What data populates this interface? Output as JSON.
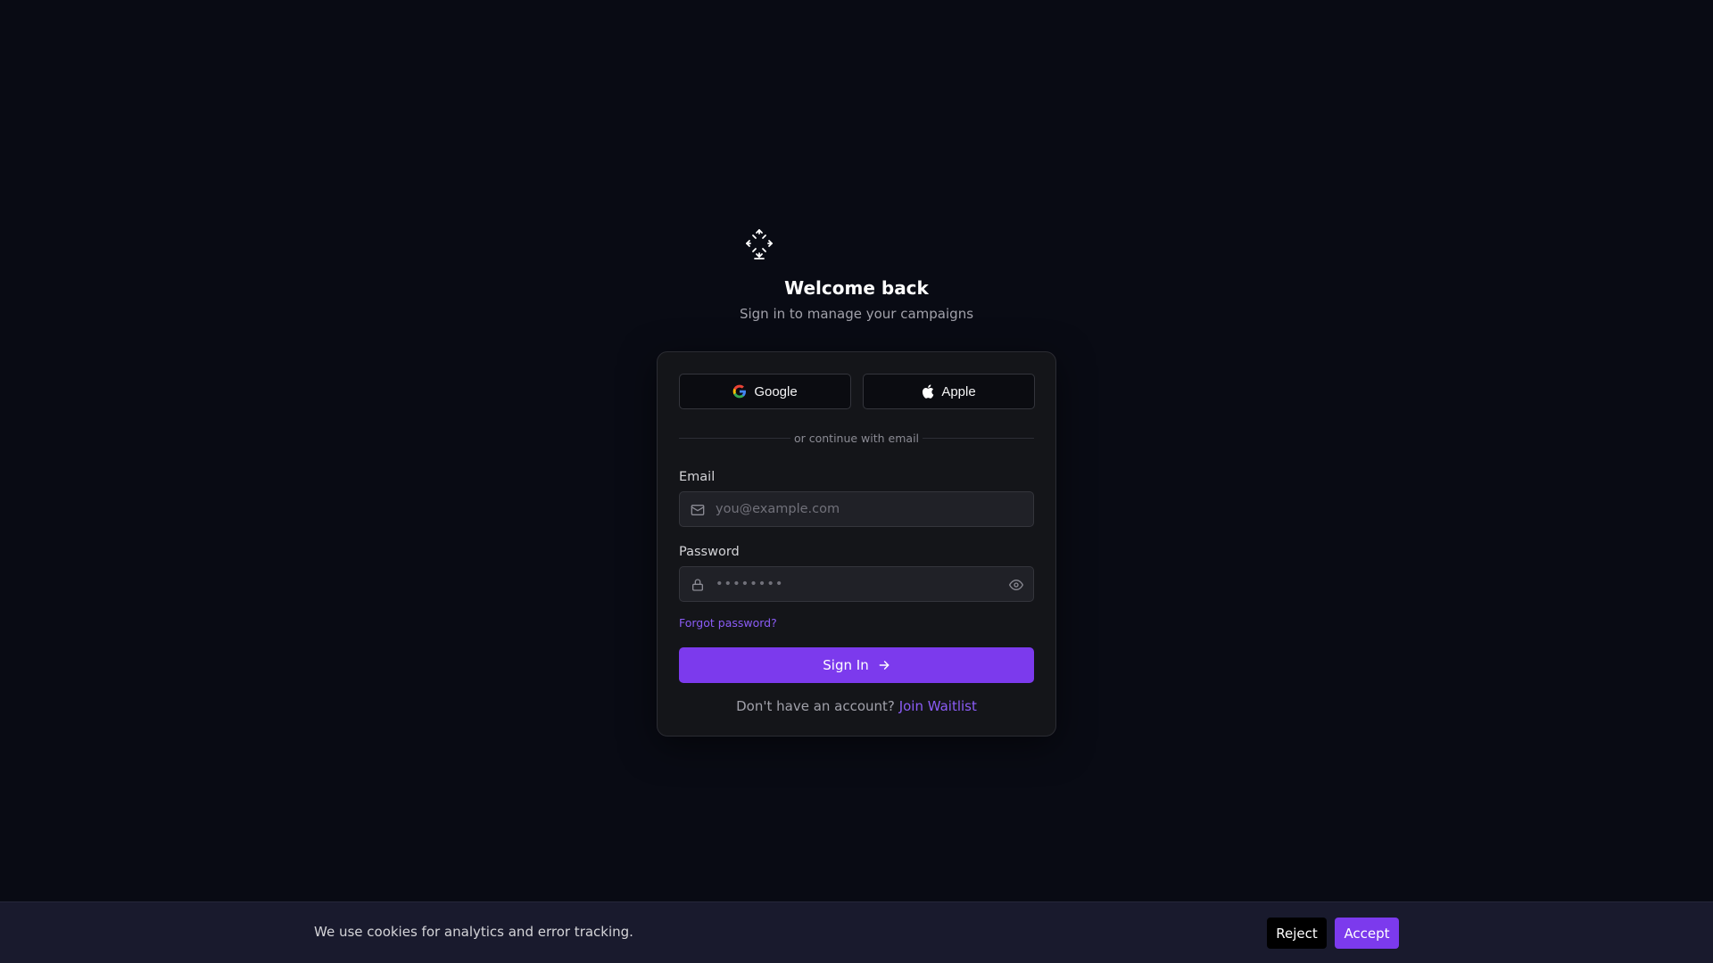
{
  "brand": {
    "logo_icon": "network-nodes-icon",
    "accent_color": "#7c3aed",
    "link_color": "#8b5cf6"
  },
  "header": {
    "title": "Welcome back",
    "subtitle": "Sign in to manage your campaigns"
  },
  "oauth": {
    "google_label": "Google",
    "google_icon": "google-icon",
    "apple_label": "Apple",
    "apple_icon": "apple-icon"
  },
  "divider": {
    "text": "or continue with email"
  },
  "form": {
    "email": {
      "label": "Email",
      "placeholder": "you@example.com",
      "value": "",
      "icon": "mail-icon"
    },
    "password": {
      "label": "Password",
      "placeholder": "••••••••",
      "value": "",
      "icon": "lock-icon",
      "toggle_icon": "eye-icon"
    },
    "forgot_label": "Forgot password?",
    "submit_label": "Sign In",
    "submit_icon": "arrow-right-icon"
  },
  "footer": {
    "prompt": "Don't have an account?",
    "link_label": "Join Waitlist"
  },
  "cookies": {
    "message": "We use cookies for analytics and error tracking.",
    "reject_label": "Reject",
    "accept_label": "Accept"
  }
}
